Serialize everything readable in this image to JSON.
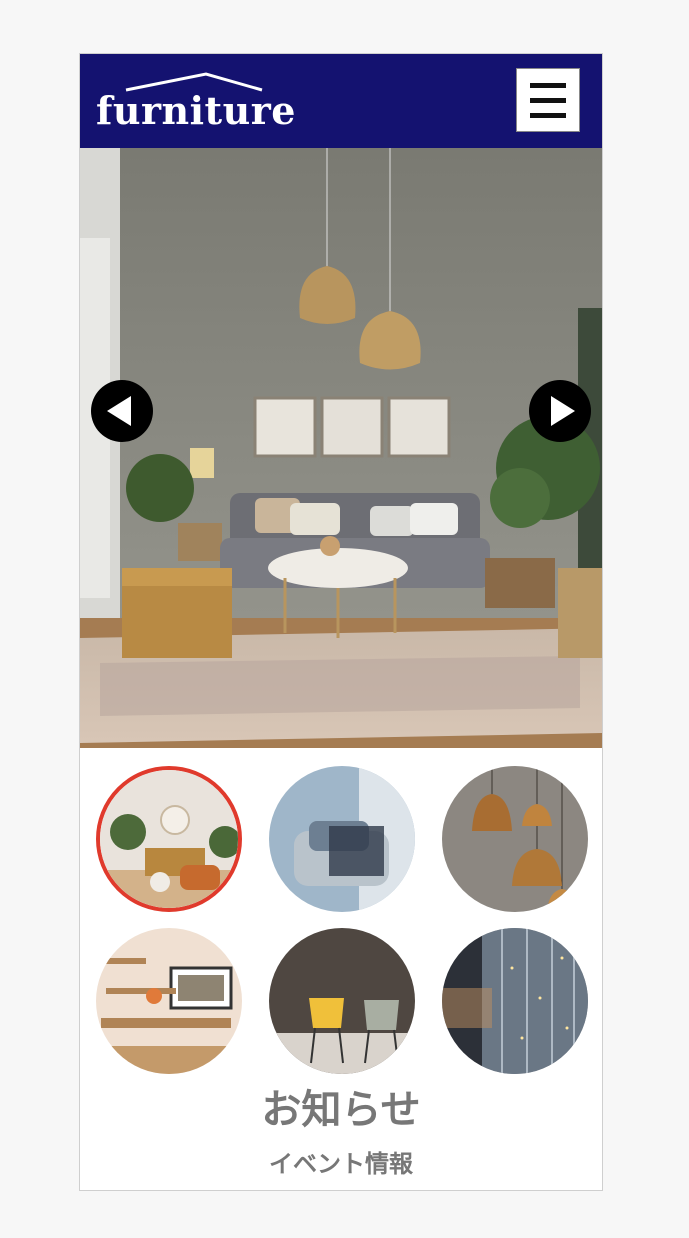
{
  "header": {
    "logo_text": "furniture",
    "background_color": "#141270",
    "menu_icon": "hamburger-icon"
  },
  "carousel": {
    "prev_icon": "arrow-left-icon",
    "next_icon": "arrow-right-icon",
    "slide_image": "living-room-photo"
  },
  "thumbnails": [
    {
      "image": "living-room-thumbnail",
      "selected": true
    },
    {
      "image": "armchair-thumbnail",
      "selected": false
    },
    {
      "image": "pendant-lamps-thumbnail",
      "selected": false
    },
    {
      "image": "wall-shelves-thumbnail",
      "selected": false
    },
    {
      "image": "chairs-thumbnail",
      "selected": false
    },
    {
      "image": "curtain-lights-thumbnail",
      "selected": false
    }
  ],
  "thumbnail_selected_border_color": "#e03a2c",
  "news": {
    "title": "お知らせ",
    "subtitle": "イベント情報"
  }
}
